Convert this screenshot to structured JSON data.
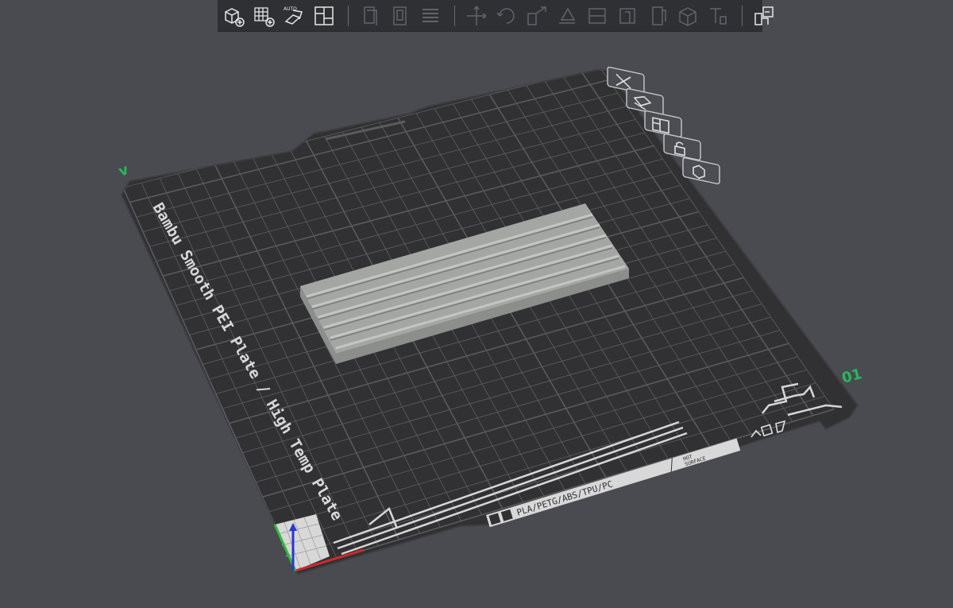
{
  "toolbar": {
    "groups": [
      [
        "add-object-icon",
        "add-plate-icon",
        "auto-orient-icon",
        "arrange-icon"
      ],
      [
        "copy-icon",
        "paste-icon",
        "layers-list-icon"
      ],
      [
        "move-icon",
        "rotate-icon",
        "scale-icon",
        "lay-on-face-icon",
        "cut-icon",
        "support-paint-icon",
        "seam-paint-icon",
        "mesh-boolean-icon",
        "text-tool-icon"
      ],
      [
        "assembly-view-icon"
      ]
    ],
    "auto_label": "AUTO"
  },
  "plate": {
    "name": "Bambu Smooth PEI Plate / High Temp Plate",
    "materials_label": "PLA/PETG/ABS/TPU/PC",
    "surface_label_line1": "HOT",
    "surface_label_line2": "SURFACE",
    "plate_number": "01",
    "corner_mark": "v",
    "colors": {
      "bed": "#313133",
      "grid": "#5a5a5e",
      "plate_mark": "#26b95a",
      "object_top": "#a4a6a4",
      "object_side": "#8c8e8c"
    }
  },
  "plate_controls": [
    "close-plate-icon",
    "auto-arrange-plate-icon",
    "plate-layout-icon",
    "lock-plate-icon",
    "plate-settings-icon"
  ],
  "axes": {
    "x_color": "#d02a2a",
    "y_color": "#2fbd3a",
    "z_color": "#2838d0"
  }
}
